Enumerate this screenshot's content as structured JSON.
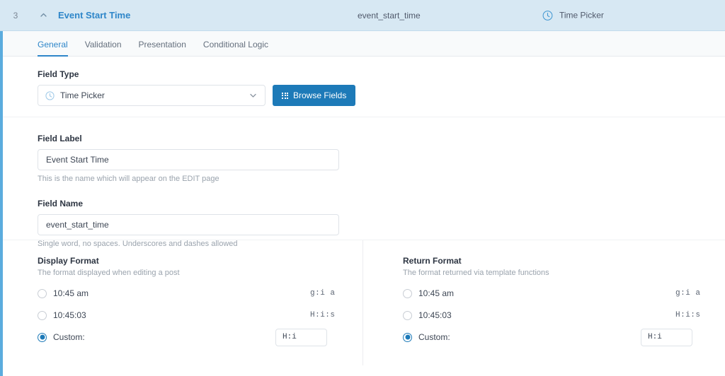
{
  "header": {
    "order": "3",
    "collapse_icon": "chevron-up-icon",
    "title": "Event Start Time",
    "field_name": "event_start_time",
    "type_icon": "clock-icon",
    "type_label": "Time Picker"
  },
  "tabs": [
    {
      "label": "General",
      "active": true
    },
    {
      "label": "Validation",
      "active": false
    },
    {
      "label": "Presentation",
      "active": false
    },
    {
      "label": "Conditional Logic",
      "active": false
    }
  ],
  "field_type": {
    "label": "Field Type",
    "select_icon": "clock-icon",
    "value": "Time Picker",
    "chevron_icon": "chevron-down-icon",
    "browse_button": {
      "icon": "grid-icon",
      "label": "Browse Fields"
    }
  },
  "field_label": {
    "label": "Field Label",
    "value": "Event Start Time",
    "hint": "This is the name which will appear on the EDIT page"
  },
  "field_name": {
    "label": "Field Name",
    "value": "event_start_time",
    "hint": "Single word, no spaces. Underscores and dashes allowed"
  },
  "display_format": {
    "title": "Display Format",
    "subtitle": "The format displayed when editing a post",
    "options": [
      {
        "label": "10:45 am",
        "code": "g:i a",
        "selected": false
      },
      {
        "label": "10:45:03",
        "code": "H:i:s",
        "selected": false
      },
      {
        "label": "Custom:",
        "code": "",
        "selected": true,
        "custom_value": "H:i"
      }
    ]
  },
  "return_format": {
    "title": "Return Format",
    "subtitle": "The format returned via template functions",
    "options": [
      {
        "label": "10:45 am",
        "code": "g:i a",
        "selected": false
      },
      {
        "label": "10:45:03",
        "code": "H:i:s",
        "selected": false
      },
      {
        "label": "Custom:",
        "code": "",
        "selected": true,
        "custom_value": "H:i"
      }
    ]
  },
  "colors": {
    "accent": "#2e86c9",
    "header_bg": "#d7e8f3",
    "button_blue": "#1d7ab8",
    "left_bar": "#5bacde"
  }
}
